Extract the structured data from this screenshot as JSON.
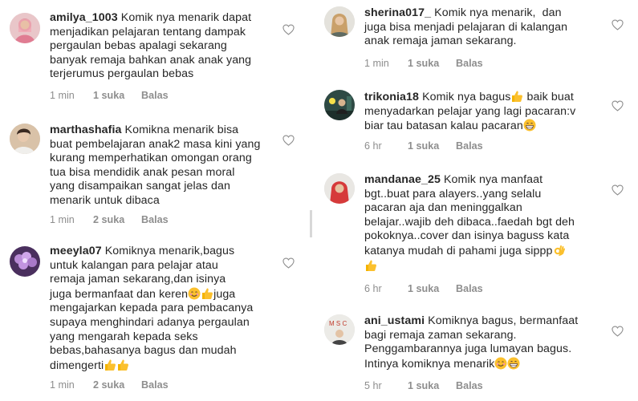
{
  "icons": {
    "like": "heart-outline-icon",
    "thumbs_up": "thumbs-up-emoji",
    "smile": "smiling-face-emoji",
    "grin": "grinning-face-emoji",
    "ok_hand": "ok-hand-emoji"
  },
  "colors": {
    "meta_text": "#8e8e8e",
    "body_text": "#262626"
  },
  "left_comments": [
    {
      "username": "amilya_1003",
      "text_parts": [
        " Komik nya menarik dapat\nmenjadikan pelajaran tentang dampak\npergaulan bebas apalagi sekarang\nbanyak remaja bahkan anak anak yang\nterjerumus pergaulan bebas"
      ],
      "time": "1 min",
      "likes": "1 suka",
      "reply": "Balas"
    },
    {
      "username": "marthashafia",
      "text_parts": [
        " Komikna menarik bisa\nbuat pembelajaran anak2 masa kini yang\nkurang memperhatikan omongan orang\ntua bisa mendidik anak pesan moral\nyang disampaikan sangat jelas dan\nmenarik untuk dibaca"
      ],
      "time": "1 min",
      "likes": "2 suka",
      "reply": "Balas"
    },
    {
      "username": "meeyla07",
      "text_parts": [
        " Komiknya menarik,bagus\nuntuk kalangan para pelajar atau\nremaja jaman sekarang,dan isinya\njuga bermanfaat dan keren",
        "juga\nmengajarkan kepada para pembacanya\nsupaya menghindari adanya pergaulan\nyang mengarah kepada seks\nbebas,bahasanya bagus dan mudah\ndimengerti"
      ],
      "time": "1 min",
      "likes": "2 suka",
      "reply": "Balas"
    }
  ],
  "right_comments": [
    {
      "username": "sherina017_",
      "text_parts": [
        " Komik nya menarik,  dan\njuga bisa menjadi pelajaran di kalangan\nanak remaja jaman sekarang."
      ],
      "time": "1 min",
      "likes": "1 suka",
      "reply": "Balas"
    },
    {
      "username": "trikonia18",
      "text_parts": [
        " Komik nya bagus",
        " baik buat\nmenyadarkan pelajar yang lagi pacaran:v\nbiar tau batasan kalau pacaran"
      ],
      "time": "6 hr",
      "likes": "1 suka",
      "reply": "Balas"
    },
    {
      "username": "mandanae_25",
      "text_parts": [
        " Komik nya manfaat\nbgt..buat para alayers..yang selalu\npacaran aja dan meninggalkan\nbelajar..wajib deh dibaca..faedah bgt deh\npokoknya..cover dan isinya baguss kata\nkatanya mudah di pahami juga sippp"
      ],
      "time": "6 hr",
      "likes": "1 suka",
      "reply": "Balas"
    },
    {
      "username": "ani_ustami",
      "text_parts": [
        " Komiknya bagus, bermanfaat\nbagi remaja zaman sekarang.\nPenggambarannya juga lumayan bagus.\nIntinya komiknya menarik"
      ],
      "time": "5 hr",
      "likes": "1 suka",
      "reply": "Balas"
    }
  ]
}
